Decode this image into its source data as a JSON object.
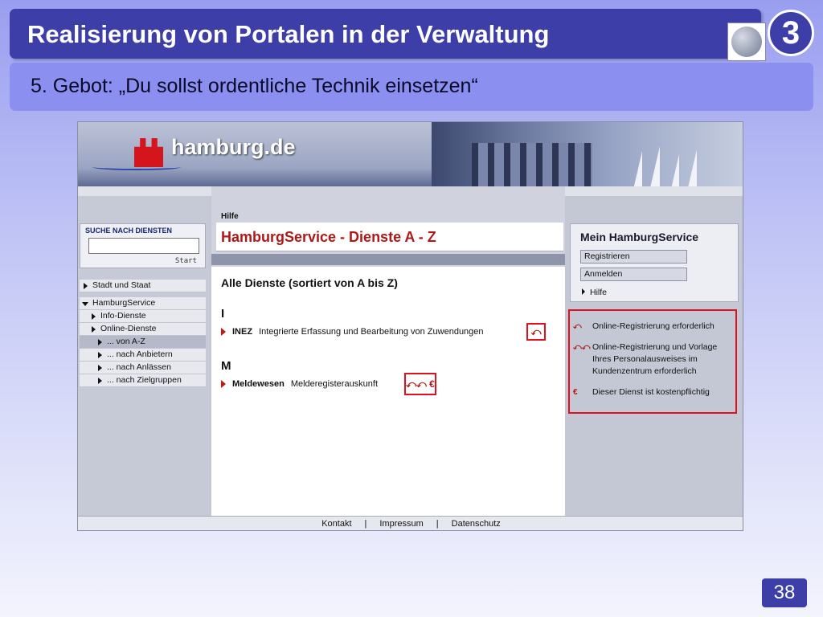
{
  "slide": {
    "title": "Realisierung von Portalen in der Verwaltung",
    "badge_number": "3",
    "subtitle": "5. Gebot: „Du sollst ordentliche Technik einsetzen“",
    "page_number": "38"
  },
  "site": {
    "brand": "hamburg.de",
    "search": {
      "label": "SUCHE NACH DIENSTEN",
      "value": "",
      "start_label": "Start"
    },
    "nav": [
      {
        "label": "Stadt und Staat",
        "level": 0,
        "expanded": false
      },
      {
        "label": "HamburgService",
        "level": 0,
        "expanded": true
      },
      {
        "label": "Info-Dienste",
        "level": 1,
        "expanded": false
      },
      {
        "label": "Online-Dienste",
        "level": 1,
        "expanded": false
      },
      {
        "label": "... von A-Z",
        "level": 2,
        "expanded": false,
        "active": true
      },
      {
        "label": "... nach Anbietern",
        "level": 2,
        "expanded": false
      },
      {
        "label": "... nach Anlässen",
        "level": 2,
        "expanded": false
      },
      {
        "label": "... nach Zielgruppen",
        "level": 2,
        "expanded": false
      }
    ],
    "breadcrumb": "Hilfe",
    "page_heading": "HamburgService - Dienste A - Z",
    "content_title": "Alle Dienste (sortiert von A bis Z)",
    "sections": [
      {
        "letter": "I",
        "entries": [
          {
            "name": "INEZ",
            "description": "Integrierte Erfassung und Bearbeitung von Zuwendungen",
            "icons": "⤺"
          }
        ]
      },
      {
        "letter": "M",
        "entries": [
          {
            "name": "Meldewesen",
            "description": "Melderegisterauskunft",
            "icons": "⤺⤺ €"
          }
        ]
      }
    ],
    "mein": {
      "title": "Mein HamburgService",
      "register": "Registrieren",
      "login": "Anmelden",
      "help": "Hilfe"
    },
    "legend": [
      {
        "symbol": "⤺",
        "text": "Online-Registrierung erforderlich"
      },
      {
        "symbol": "⤺⤺",
        "text": "Online-Registrierung und Vorlage Ihres Personalausweises im Kundenzentrum erforderlich"
      },
      {
        "symbol": "€",
        "text": "Dieser Dienst ist kostenpflichtig"
      }
    ],
    "footer": [
      "Kontakt",
      "|",
      "Impressum",
      "|",
      "Datenschutz"
    ],
    "colors": {
      "title_bar": "#3d3ea8",
      "subtitle_bar": "#8b8ff0",
      "accent_red": "#b01818",
      "highlight_red": "#e01020"
    }
  }
}
